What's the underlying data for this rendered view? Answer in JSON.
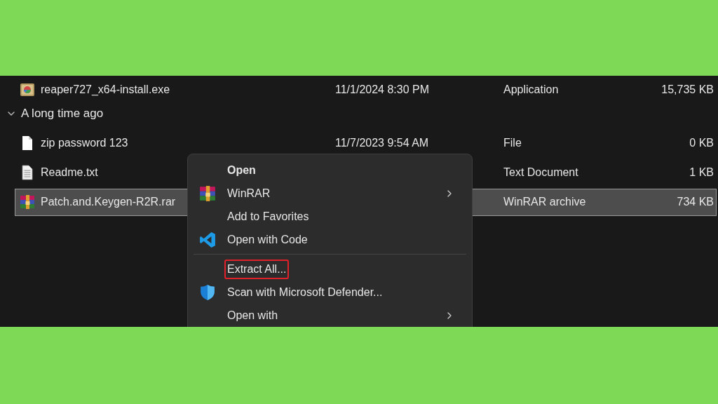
{
  "file_list": {
    "rows": [
      {
        "kind": "file",
        "name": "reaper727_x64-install.exe",
        "date": "11/1/2024 8:30 PM",
        "type": "Application",
        "size": "15,735 KB",
        "selected": false
      },
      {
        "kind": "group",
        "label": "A long time ago",
        "expanded": true
      },
      {
        "kind": "file",
        "name": "zip password 123",
        "date": "11/7/2023 9:54 AM",
        "type": "File",
        "size": "0 KB",
        "selected": false
      },
      {
        "kind": "file",
        "name": "Readme.txt",
        "type": "Text Document",
        "size": "1 KB",
        "selected": false
      },
      {
        "kind": "file",
        "name": "Patch.and.Keygen-R2R.rar",
        "type": "WinRAR archive",
        "size": "734 KB",
        "selected": true
      }
    ]
  },
  "context_menu": {
    "items": [
      {
        "kind": "item",
        "label": "Open",
        "default": true,
        "submenu": false,
        "annotated": false
      },
      {
        "kind": "item",
        "label": "WinRAR",
        "default": false,
        "submenu": true,
        "annotated": false
      },
      {
        "kind": "item",
        "label": "Add to Favorites",
        "default": false,
        "submenu": false,
        "annotated": false
      },
      {
        "kind": "item",
        "label": "Open with Code",
        "default": false,
        "submenu": false,
        "annotated": false
      },
      {
        "kind": "separator"
      },
      {
        "kind": "item",
        "label": "Extract All...",
        "default": false,
        "submenu": false,
        "annotated": true
      },
      {
        "kind": "item",
        "label": "Scan with Microsoft Defender...",
        "default": false,
        "submenu": false,
        "annotated": false
      },
      {
        "kind": "item",
        "label": "Open with",
        "default": false,
        "submenu": true,
        "annotated": false
      }
    ]
  }
}
